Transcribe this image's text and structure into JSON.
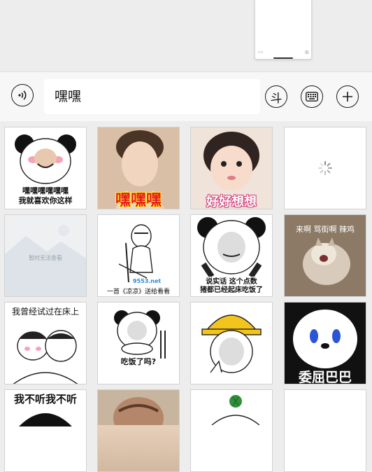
{
  "preview_card": {
    "small_text": "ico"
  },
  "input": {
    "value": "嘿嘿"
  },
  "toolbar": {
    "dou_label": "斗"
  },
  "stickers": [
    {
      "caption": "嘿嘿嘿嘿嘿嘿\n我就喜欢你这样"
    },
    {
      "caption": "嘿嘿嘿"
    },
    {
      "caption": "好好想想"
    },
    {
      "caption": ""
    },
    {
      "caption": "暂时无法查看"
    },
    {
      "caption": "一首《凉凉》送给看看",
      "watermark": "9553.net"
    },
    {
      "caption": "说实话 这个点数\n猪都已经起床吃饭了"
    },
    {
      "caption": "来啊 骂街啊 辣鸡"
    },
    {
      "caption": "我曾经试过在床上"
    },
    {
      "caption": "吃饭了吗?"
    },
    {
      "caption": ""
    },
    {
      "caption": "委屈巴巴"
    },
    {
      "caption": "我不听我不听"
    },
    {
      "caption": ""
    },
    {
      "caption": ""
    },
    {
      "caption": ""
    }
  ]
}
